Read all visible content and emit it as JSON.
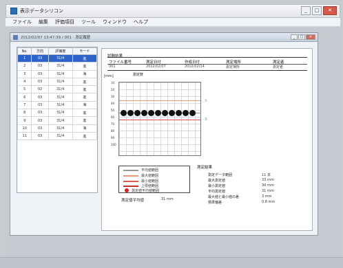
{
  "window": {
    "title": "表示データシリコン",
    "min": "_",
    "max": "□",
    "close": "✕"
  },
  "menu": [
    "ファイル",
    "編集",
    "評価項目",
    "ツール",
    "ウィンドウ",
    "ヘルプ"
  ],
  "child": {
    "title": "2012/02/07 13:47:39 / 001 · 測定履歴",
    "min": "_",
    "max": "□",
    "close": "✕"
  },
  "table": {
    "headers": [
      "No.",
      "方向",
      "評価度",
      "モード"
    ],
    "rows": [
      [
        "1",
        "03",
        "31/4",
        "進"
      ],
      [
        "2",
        "03",
        "31/4",
        "進"
      ],
      [
        "3",
        "03",
        "31/4",
        "海"
      ],
      [
        "4",
        "03",
        "31/4",
        "進"
      ],
      [
        "5",
        "02",
        "31/4",
        "進"
      ],
      [
        "6",
        "03",
        "31/4",
        "進"
      ],
      [
        "7",
        "03",
        "31/4",
        "海"
      ],
      [
        "8",
        "03",
        "31/4",
        "進"
      ],
      [
        "9",
        "03",
        "31/4",
        "進"
      ],
      [
        "10",
        "03",
        "31/4",
        "海"
      ],
      [
        "11",
        "03",
        "31/4",
        "進"
      ]
    ]
  },
  "report": {
    "title": "試験結果",
    "info_labels": [
      "ファイル番号",
      "測定日付",
      "作成日付",
      "測定場所",
      "測定者"
    ],
    "info_values": [
      "001",
      "2012/02/07",
      "2012/02/14",
      "測定場所",
      "測定者"
    ],
    "y_unit": "[mm]",
    "x_label": "測定数",
    "y_ticks": [
      "10",
      "20",
      "30",
      "40",
      "50",
      "60",
      "70",
      "80",
      "90",
      "100"
    ],
    "top_tag": "上",
    "bottom_tag": "下",
    "legend": [
      "平均値範囲",
      "最大値範囲",
      "最小値範囲",
      "上限値範囲"
    ],
    "legend_dot": "測定値平均値範囲",
    "footer_label": "測定値平均値",
    "footer_value": "31 mm",
    "results_title": "測定結果",
    "results": [
      {
        "label": "測定データ範囲",
        "value": "11 本"
      },
      {
        "label": "最大測定値",
        "value": "33 mm"
      },
      {
        "label": "最小測定値",
        "value": "30 mm"
      },
      {
        "label": "平均測定値",
        "value": "31 mm"
      },
      {
        "label": "最大値と最小値の差",
        "value": "3 mm"
      },
      {
        "label": "標準偏差",
        "value": "0.8 mm"
      }
    ]
  },
  "colors": {
    "selection": "#2e63c9",
    "upper_line": "#e0584a",
    "lower_line": "#e59a7a",
    "mean_line": "#999999"
  }
}
